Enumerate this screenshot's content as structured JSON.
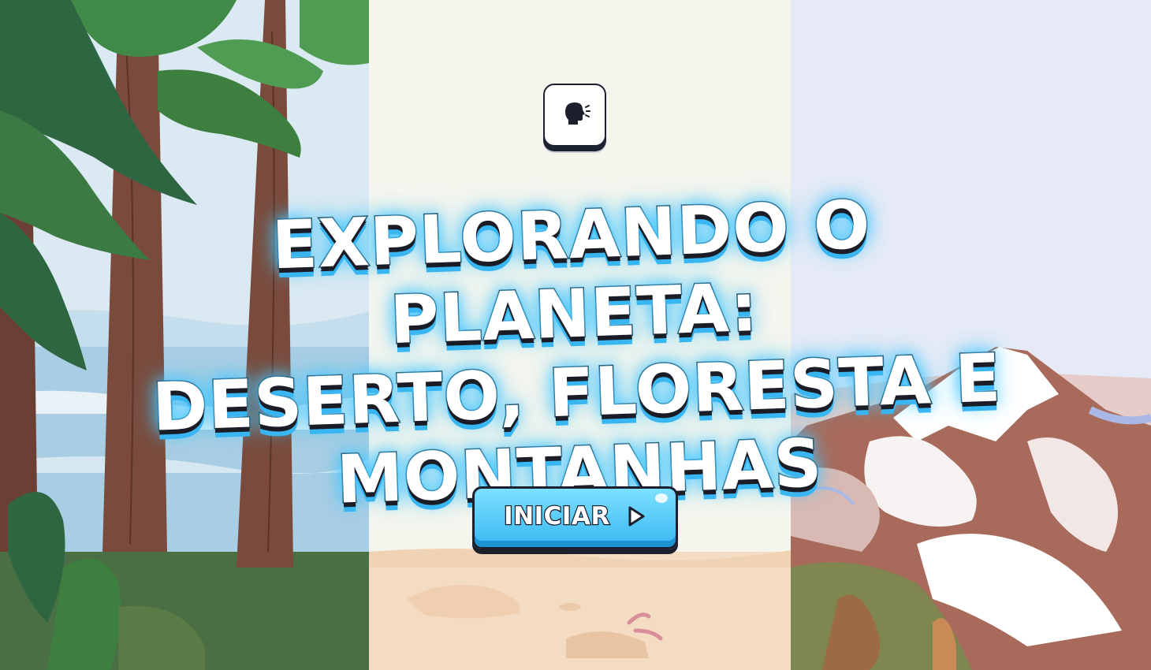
{
  "title": {
    "line1": "EXPLORANDO O PLANETA:",
    "line2": "DESERTO, FLORESTA E",
    "line3": "MONTANHAS"
  },
  "buttons": {
    "start_label": "INICIAR",
    "start_icon": "play-triangle-icon",
    "speak_icon": "speaking-head-icon"
  },
  "colors": {
    "accent": "#39b8f2",
    "outline": "#1c1f2c",
    "title_glow": "#44c6ff"
  }
}
